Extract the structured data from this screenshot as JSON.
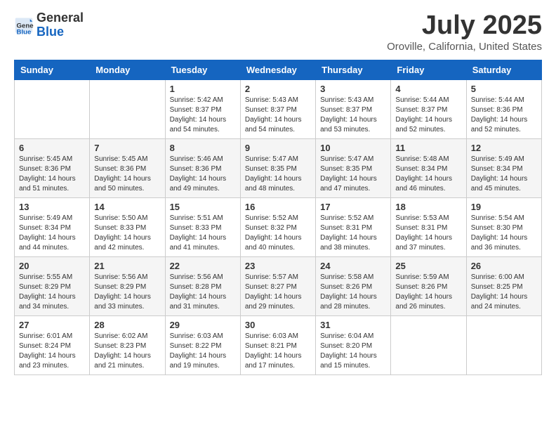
{
  "header": {
    "logo_general": "General",
    "logo_blue": "Blue",
    "month_title": "July 2025",
    "location": "Oroville, California, United States"
  },
  "weekdays": [
    "Sunday",
    "Monday",
    "Tuesday",
    "Wednesday",
    "Thursday",
    "Friday",
    "Saturday"
  ],
  "weeks": [
    [
      {
        "day": "",
        "sunrise": "",
        "sunset": "",
        "daylight": ""
      },
      {
        "day": "",
        "sunrise": "",
        "sunset": "",
        "daylight": ""
      },
      {
        "day": "1",
        "sunrise": "Sunrise: 5:42 AM",
        "sunset": "Sunset: 8:37 PM",
        "daylight": "Daylight: 14 hours and 54 minutes."
      },
      {
        "day": "2",
        "sunrise": "Sunrise: 5:43 AM",
        "sunset": "Sunset: 8:37 PM",
        "daylight": "Daylight: 14 hours and 54 minutes."
      },
      {
        "day": "3",
        "sunrise": "Sunrise: 5:43 AM",
        "sunset": "Sunset: 8:37 PM",
        "daylight": "Daylight: 14 hours and 53 minutes."
      },
      {
        "day": "4",
        "sunrise": "Sunrise: 5:44 AM",
        "sunset": "Sunset: 8:37 PM",
        "daylight": "Daylight: 14 hours and 52 minutes."
      },
      {
        "day": "5",
        "sunrise": "Sunrise: 5:44 AM",
        "sunset": "Sunset: 8:36 PM",
        "daylight": "Daylight: 14 hours and 52 minutes."
      }
    ],
    [
      {
        "day": "6",
        "sunrise": "Sunrise: 5:45 AM",
        "sunset": "Sunset: 8:36 PM",
        "daylight": "Daylight: 14 hours and 51 minutes."
      },
      {
        "day": "7",
        "sunrise": "Sunrise: 5:45 AM",
        "sunset": "Sunset: 8:36 PM",
        "daylight": "Daylight: 14 hours and 50 minutes."
      },
      {
        "day": "8",
        "sunrise": "Sunrise: 5:46 AM",
        "sunset": "Sunset: 8:36 PM",
        "daylight": "Daylight: 14 hours and 49 minutes."
      },
      {
        "day": "9",
        "sunrise": "Sunrise: 5:47 AM",
        "sunset": "Sunset: 8:35 PM",
        "daylight": "Daylight: 14 hours and 48 minutes."
      },
      {
        "day": "10",
        "sunrise": "Sunrise: 5:47 AM",
        "sunset": "Sunset: 8:35 PM",
        "daylight": "Daylight: 14 hours and 47 minutes."
      },
      {
        "day": "11",
        "sunrise": "Sunrise: 5:48 AM",
        "sunset": "Sunset: 8:34 PM",
        "daylight": "Daylight: 14 hours and 46 minutes."
      },
      {
        "day": "12",
        "sunrise": "Sunrise: 5:49 AM",
        "sunset": "Sunset: 8:34 PM",
        "daylight": "Daylight: 14 hours and 45 minutes."
      }
    ],
    [
      {
        "day": "13",
        "sunrise": "Sunrise: 5:49 AM",
        "sunset": "Sunset: 8:34 PM",
        "daylight": "Daylight: 14 hours and 44 minutes."
      },
      {
        "day": "14",
        "sunrise": "Sunrise: 5:50 AM",
        "sunset": "Sunset: 8:33 PM",
        "daylight": "Daylight: 14 hours and 42 minutes."
      },
      {
        "day": "15",
        "sunrise": "Sunrise: 5:51 AM",
        "sunset": "Sunset: 8:33 PM",
        "daylight": "Daylight: 14 hours and 41 minutes."
      },
      {
        "day": "16",
        "sunrise": "Sunrise: 5:52 AM",
        "sunset": "Sunset: 8:32 PM",
        "daylight": "Daylight: 14 hours and 40 minutes."
      },
      {
        "day": "17",
        "sunrise": "Sunrise: 5:52 AM",
        "sunset": "Sunset: 8:31 PM",
        "daylight": "Daylight: 14 hours and 38 minutes."
      },
      {
        "day": "18",
        "sunrise": "Sunrise: 5:53 AM",
        "sunset": "Sunset: 8:31 PM",
        "daylight": "Daylight: 14 hours and 37 minutes."
      },
      {
        "day": "19",
        "sunrise": "Sunrise: 5:54 AM",
        "sunset": "Sunset: 8:30 PM",
        "daylight": "Daylight: 14 hours and 36 minutes."
      }
    ],
    [
      {
        "day": "20",
        "sunrise": "Sunrise: 5:55 AM",
        "sunset": "Sunset: 8:29 PM",
        "daylight": "Daylight: 14 hours and 34 minutes."
      },
      {
        "day": "21",
        "sunrise": "Sunrise: 5:56 AM",
        "sunset": "Sunset: 8:29 PM",
        "daylight": "Daylight: 14 hours and 33 minutes."
      },
      {
        "day": "22",
        "sunrise": "Sunrise: 5:56 AM",
        "sunset": "Sunset: 8:28 PM",
        "daylight": "Daylight: 14 hours and 31 minutes."
      },
      {
        "day": "23",
        "sunrise": "Sunrise: 5:57 AM",
        "sunset": "Sunset: 8:27 PM",
        "daylight": "Daylight: 14 hours and 29 minutes."
      },
      {
        "day": "24",
        "sunrise": "Sunrise: 5:58 AM",
        "sunset": "Sunset: 8:26 PM",
        "daylight": "Daylight: 14 hours and 28 minutes."
      },
      {
        "day": "25",
        "sunrise": "Sunrise: 5:59 AM",
        "sunset": "Sunset: 8:26 PM",
        "daylight": "Daylight: 14 hours and 26 minutes."
      },
      {
        "day": "26",
        "sunrise": "Sunrise: 6:00 AM",
        "sunset": "Sunset: 8:25 PM",
        "daylight": "Daylight: 14 hours and 24 minutes."
      }
    ],
    [
      {
        "day": "27",
        "sunrise": "Sunrise: 6:01 AM",
        "sunset": "Sunset: 8:24 PM",
        "daylight": "Daylight: 14 hours and 23 minutes."
      },
      {
        "day": "28",
        "sunrise": "Sunrise: 6:02 AM",
        "sunset": "Sunset: 8:23 PM",
        "daylight": "Daylight: 14 hours and 21 minutes."
      },
      {
        "day": "29",
        "sunrise": "Sunrise: 6:03 AM",
        "sunset": "Sunset: 8:22 PM",
        "daylight": "Daylight: 14 hours and 19 minutes."
      },
      {
        "day": "30",
        "sunrise": "Sunrise: 6:03 AM",
        "sunset": "Sunset: 8:21 PM",
        "daylight": "Daylight: 14 hours and 17 minutes."
      },
      {
        "day": "31",
        "sunrise": "Sunrise: 6:04 AM",
        "sunset": "Sunset: 8:20 PM",
        "daylight": "Daylight: 14 hours and 15 minutes."
      },
      {
        "day": "",
        "sunrise": "",
        "sunset": "",
        "daylight": ""
      },
      {
        "day": "",
        "sunrise": "",
        "sunset": "",
        "daylight": ""
      }
    ]
  ]
}
